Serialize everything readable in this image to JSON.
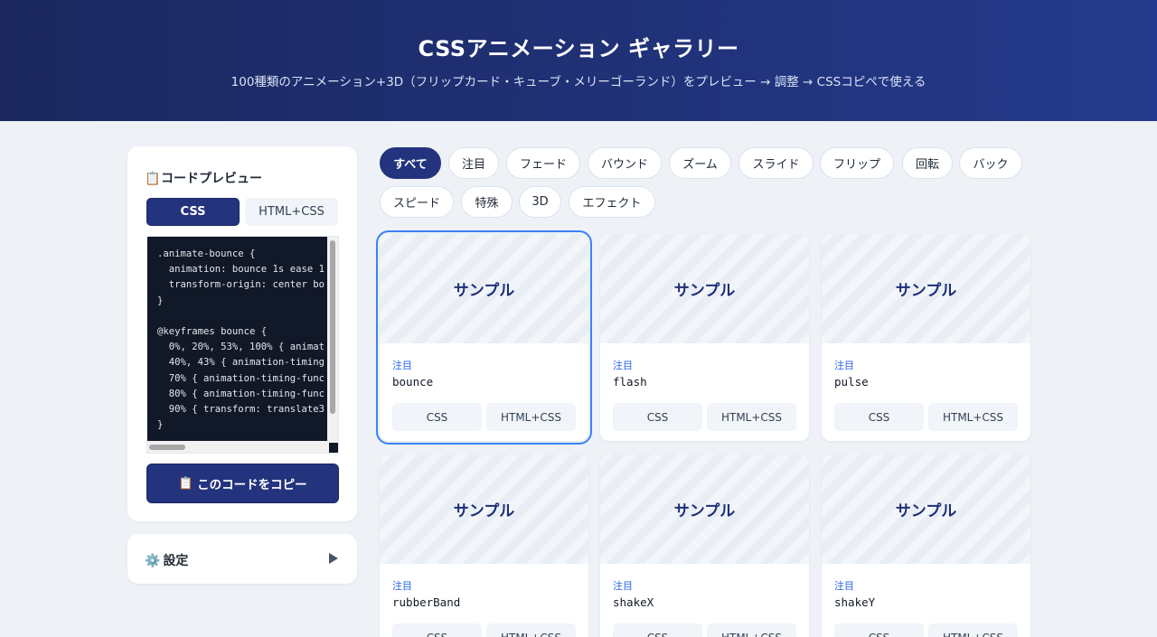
{
  "header": {
    "title": "CSSアニメーション ギャラリー",
    "subtitle": "100種類のアニメーション+3D（フリップカード・キューブ・メリーゴーランド）をプレビュー → 調整 → CSSコピペで使える"
  },
  "code_panel": {
    "icon": "clipboard-icon",
    "title": "コードプレビュー",
    "tabs": {
      "css": "CSS",
      "html_css": "HTML+CSS",
      "active": "CSS"
    },
    "code": ".animate-bounce {\n  animation: bounce 1s ease 1\n  transform-origin: center bo\n}\n\n@keyframes bounce {\n  0%, 20%, 53%, 100% { animat\n  40%, 43% { animation-timing\n  70% { animation-timing-func\n  80% { animation-timing-func\n  90% { transform: translate3\n}",
    "copy_label": "このコードをコピー"
  },
  "settings": {
    "icon": "gear-icon",
    "label": "設定"
  },
  "filters": [
    "すべて",
    "注目",
    "フェード",
    "バウンド",
    "ズーム",
    "スライド",
    "フリップ",
    "回転",
    "バック",
    "スピード",
    "特殊",
    "3D",
    "エフェクト"
  ],
  "active_filter": "すべて",
  "cards": [
    {
      "preview": "サンプル",
      "category": "注目",
      "name": "bounce",
      "btn_css": "CSS",
      "btn_html": "HTML+CSS",
      "selected": true
    },
    {
      "preview": "サンプル",
      "category": "注目",
      "name": "flash",
      "btn_css": "CSS",
      "btn_html": "HTML+CSS"
    },
    {
      "preview": "サンプル",
      "category": "注目",
      "name": "pulse",
      "btn_css": "CSS",
      "btn_html": "HTML+CSS"
    },
    {
      "preview": "サンプル",
      "category": "注目",
      "name": "rubberBand",
      "btn_css": "CSS",
      "btn_html": "HTML+CSS"
    },
    {
      "preview": "サンプル",
      "category": "注目",
      "name": "shakeX",
      "btn_css": "CSS",
      "btn_html": "HTML+CSS"
    },
    {
      "preview": "サンプル",
      "category": "注目",
      "name": "shakeY",
      "btn_css": "CSS",
      "btn_html": "HTML+CSS"
    }
  ]
}
